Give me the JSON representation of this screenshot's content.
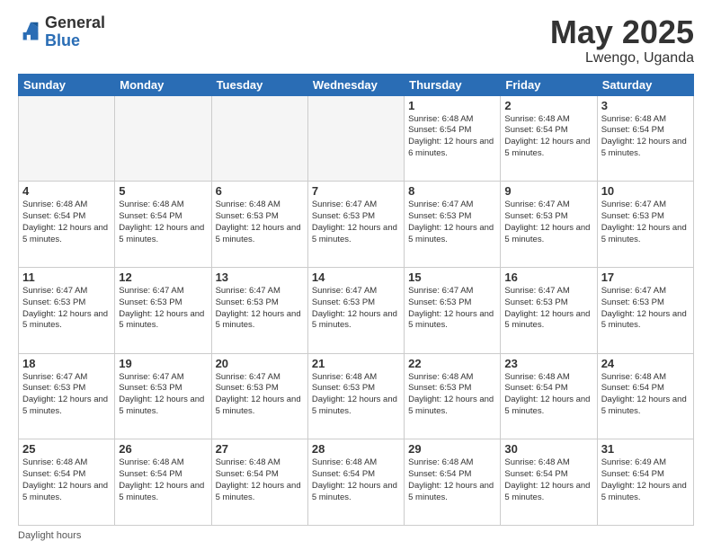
{
  "logo": {
    "general": "General",
    "blue": "Blue"
  },
  "title": {
    "month": "May 2025",
    "location": "Lwengo, Uganda"
  },
  "days_of_week": [
    "Sunday",
    "Monday",
    "Tuesday",
    "Wednesday",
    "Thursday",
    "Friday",
    "Saturday"
  ],
  "footer": {
    "daylight_label": "Daylight hours"
  },
  "weeks": [
    [
      {
        "day": "",
        "info": ""
      },
      {
        "day": "",
        "info": ""
      },
      {
        "day": "",
        "info": ""
      },
      {
        "day": "",
        "info": ""
      },
      {
        "day": "1",
        "info": "Sunrise: 6:48 AM\nSunset: 6:54 PM\nDaylight: 12 hours\nand 6 minutes."
      },
      {
        "day": "2",
        "info": "Sunrise: 6:48 AM\nSunset: 6:54 PM\nDaylight: 12 hours\nand 5 minutes."
      },
      {
        "day": "3",
        "info": "Sunrise: 6:48 AM\nSunset: 6:54 PM\nDaylight: 12 hours\nand 5 minutes."
      }
    ],
    [
      {
        "day": "4",
        "info": "Sunrise: 6:48 AM\nSunset: 6:54 PM\nDaylight: 12 hours\nand 5 minutes."
      },
      {
        "day": "5",
        "info": "Sunrise: 6:48 AM\nSunset: 6:54 PM\nDaylight: 12 hours\nand 5 minutes."
      },
      {
        "day": "6",
        "info": "Sunrise: 6:48 AM\nSunset: 6:53 PM\nDaylight: 12 hours\nand 5 minutes."
      },
      {
        "day": "7",
        "info": "Sunrise: 6:47 AM\nSunset: 6:53 PM\nDaylight: 12 hours\nand 5 minutes."
      },
      {
        "day": "8",
        "info": "Sunrise: 6:47 AM\nSunset: 6:53 PM\nDaylight: 12 hours\nand 5 minutes."
      },
      {
        "day": "9",
        "info": "Sunrise: 6:47 AM\nSunset: 6:53 PM\nDaylight: 12 hours\nand 5 minutes."
      },
      {
        "day": "10",
        "info": "Sunrise: 6:47 AM\nSunset: 6:53 PM\nDaylight: 12 hours\nand 5 minutes."
      }
    ],
    [
      {
        "day": "11",
        "info": "Sunrise: 6:47 AM\nSunset: 6:53 PM\nDaylight: 12 hours\nand 5 minutes."
      },
      {
        "day": "12",
        "info": "Sunrise: 6:47 AM\nSunset: 6:53 PM\nDaylight: 12 hours\nand 5 minutes."
      },
      {
        "day": "13",
        "info": "Sunrise: 6:47 AM\nSunset: 6:53 PM\nDaylight: 12 hours\nand 5 minutes."
      },
      {
        "day": "14",
        "info": "Sunrise: 6:47 AM\nSunset: 6:53 PM\nDaylight: 12 hours\nand 5 minutes."
      },
      {
        "day": "15",
        "info": "Sunrise: 6:47 AM\nSunset: 6:53 PM\nDaylight: 12 hours\nand 5 minutes."
      },
      {
        "day": "16",
        "info": "Sunrise: 6:47 AM\nSunset: 6:53 PM\nDaylight: 12 hours\nand 5 minutes."
      },
      {
        "day": "17",
        "info": "Sunrise: 6:47 AM\nSunset: 6:53 PM\nDaylight: 12 hours\nand 5 minutes."
      }
    ],
    [
      {
        "day": "18",
        "info": "Sunrise: 6:47 AM\nSunset: 6:53 PM\nDaylight: 12 hours\nand 5 minutes."
      },
      {
        "day": "19",
        "info": "Sunrise: 6:47 AM\nSunset: 6:53 PM\nDaylight: 12 hours\nand 5 minutes."
      },
      {
        "day": "20",
        "info": "Sunrise: 6:47 AM\nSunset: 6:53 PM\nDaylight: 12 hours\nand 5 minutes."
      },
      {
        "day": "21",
        "info": "Sunrise: 6:48 AM\nSunset: 6:53 PM\nDaylight: 12 hours\nand 5 minutes."
      },
      {
        "day": "22",
        "info": "Sunrise: 6:48 AM\nSunset: 6:53 PM\nDaylight: 12 hours\nand 5 minutes."
      },
      {
        "day": "23",
        "info": "Sunrise: 6:48 AM\nSunset: 6:54 PM\nDaylight: 12 hours\nand 5 minutes."
      },
      {
        "day": "24",
        "info": "Sunrise: 6:48 AM\nSunset: 6:54 PM\nDaylight: 12 hours\nand 5 minutes."
      }
    ],
    [
      {
        "day": "25",
        "info": "Sunrise: 6:48 AM\nSunset: 6:54 PM\nDaylight: 12 hours\nand 5 minutes."
      },
      {
        "day": "26",
        "info": "Sunrise: 6:48 AM\nSunset: 6:54 PM\nDaylight: 12 hours\nand 5 minutes."
      },
      {
        "day": "27",
        "info": "Sunrise: 6:48 AM\nSunset: 6:54 PM\nDaylight: 12 hours\nand 5 minutes."
      },
      {
        "day": "28",
        "info": "Sunrise: 6:48 AM\nSunset: 6:54 PM\nDaylight: 12 hours\nand 5 minutes."
      },
      {
        "day": "29",
        "info": "Sunrise: 6:48 AM\nSunset: 6:54 PM\nDaylight: 12 hours\nand 5 minutes."
      },
      {
        "day": "30",
        "info": "Sunrise: 6:48 AM\nSunset: 6:54 PM\nDaylight: 12 hours\nand 5 minutes."
      },
      {
        "day": "31",
        "info": "Sunrise: 6:49 AM\nSunset: 6:54 PM\nDaylight: 12 hours\nand 5 minutes."
      }
    ]
  ]
}
